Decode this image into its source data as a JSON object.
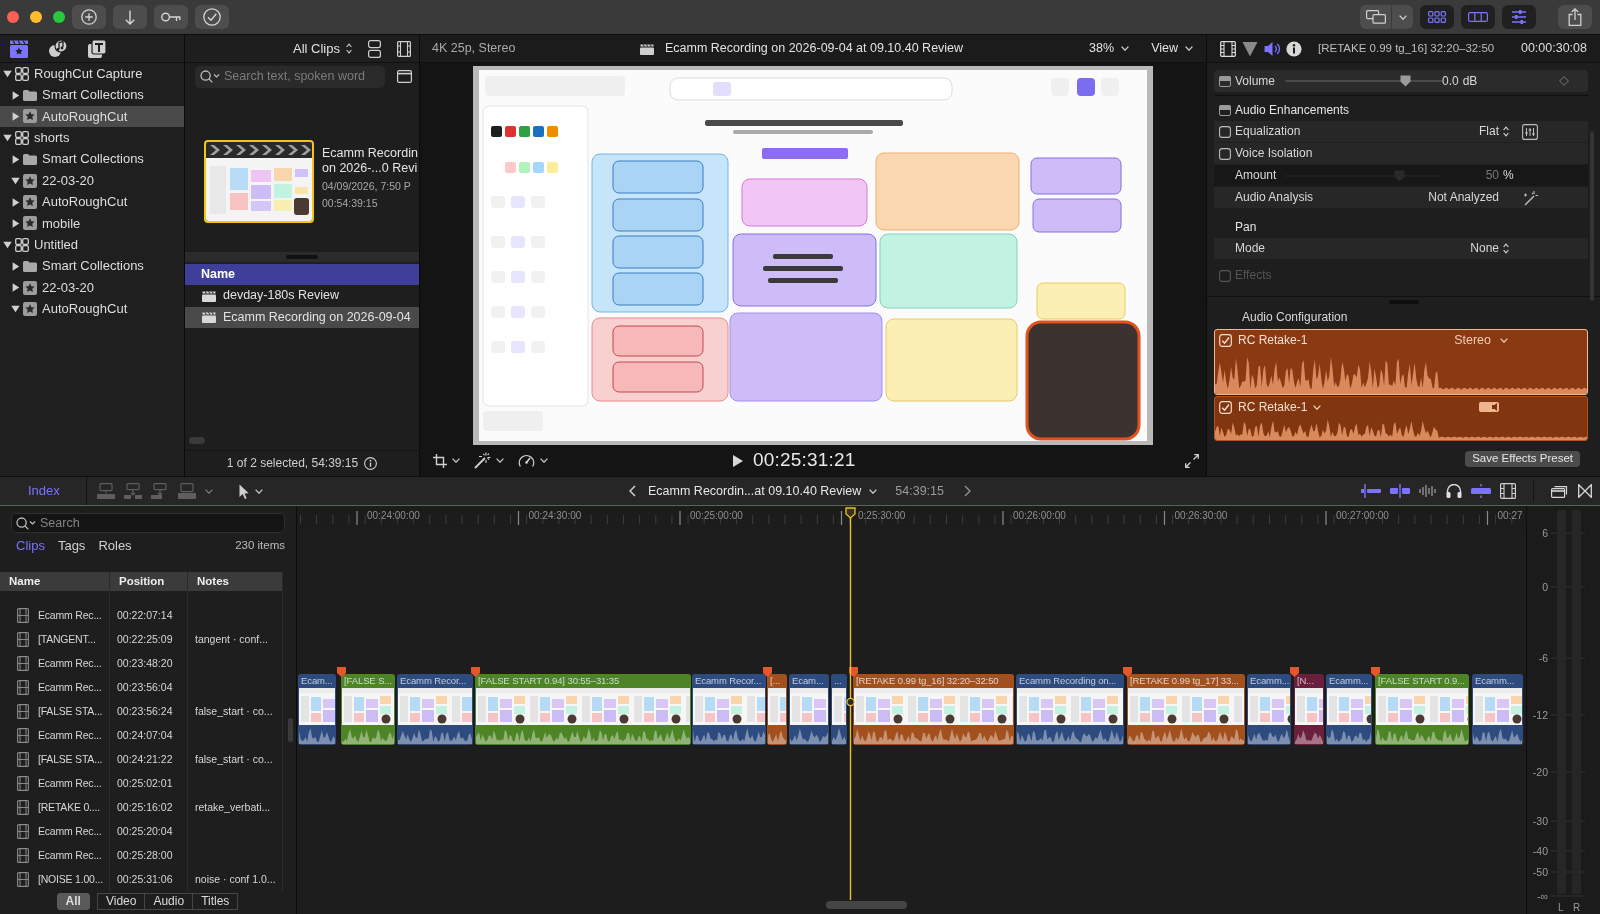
{
  "toolbar": {
    "view_toggles": [
      {
        "on": true
      },
      {
        "on": true
      },
      {
        "on": true
      }
    ]
  },
  "library": {
    "tabs": [
      {
        "selected": true
      },
      {
        "selected": false
      },
      {
        "selected": false
      }
    ],
    "tree": [
      {
        "label": "RoughCut Capture",
        "kind": "library",
        "expanded": true,
        "selected": false,
        "children": [
          {
            "label": "Smart Collections",
            "kind": "folder",
            "expanded": false,
            "selected": false
          },
          {
            "label": "AutoRoughCut",
            "kind": "event",
            "expanded": false,
            "selected": true
          }
        ]
      },
      {
        "label": "shorts",
        "kind": "library",
        "expanded": true,
        "selected": false,
        "children": [
          {
            "label": "Smart Collections",
            "kind": "folder",
            "expanded": false,
            "selected": false
          },
          {
            "label": "22-03-20",
            "kind": "event",
            "expanded": true,
            "selected": false
          },
          {
            "label": "AutoRoughCut",
            "kind": "event",
            "expanded": false,
            "selected": false
          },
          {
            "label": "mobile",
            "kind": "event",
            "expanded": false,
            "selected": false
          }
        ]
      },
      {
        "label": "Untitled",
        "kind": "library",
        "expanded": true,
        "selected": false,
        "children": [
          {
            "label": "Smart Collections",
            "kind": "folder",
            "expanded": false,
            "selected": false
          },
          {
            "label": "22-03-20",
            "kind": "event",
            "expanded": false,
            "selected": false
          },
          {
            "label": "AutoRoughCut",
            "kind": "event",
            "expanded": true,
            "selected": false
          }
        ]
      }
    ]
  },
  "browser": {
    "filter": "All Clips",
    "search": {
      "placeholder": "Search text, spoken word"
    },
    "clip": {
      "title_lines": [
        "Ecamm Recordin",
        "on 2026-...0 Revi"
      ],
      "date": "04/09/2026, 7:50 P",
      "duration": "00:54:39:15",
      "selected": true
    },
    "list": {
      "column": "Name",
      "rows": [
        {
          "name": "devday-180s Review",
          "selected": false
        },
        {
          "name": "Ecamm Recording on 2026-09-04",
          "selected": true
        }
      ]
    },
    "status": "1 of 2 selected, 54:39:15"
  },
  "viewer": {
    "format": "4K 25p, Stereo",
    "title": "Ecamm Recording on 2026-09-04 at 09.10.40 Review",
    "zoom": "38%",
    "view": "View",
    "timecode": "00:25:31:21"
  },
  "inspector": {
    "tabs": [
      {
        "selected": false
      },
      {
        "selected": false
      },
      {
        "selected": true
      },
      {
        "selected": false
      }
    ],
    "clip_name": "[RETAKE 0.99 tg_16] 32:20–32:50",
    "duration": "00:00:30:08",
    "volume": {
      "label": "Volume",
      "level": 0.77,
      "value": "0.0",
      "unit": "dB"
    },
    "sections": [
      {
        "title": "Audio Enhancements",
        "kind": "panel",
        "rows": [
          {
            "kind": "checkbox",
            "label": "Equalization",
            "checked": false,
            "value": "Flat"
          },
          {
            "kind": "checkbox",
            "label": "Voice Isolation",
            "checked": false
          },
          {
            "kind": "slider",
            "label": "Amount",
            "value": "50",
            "unit": "%",
            "level": 0.73
          },
          {
            "kind": "value",
            "label": "Audio Analysis",
            "value": "Not Analyzed"
          }
        ]
      },
      {
        "title": "Pan",
        "kind": "heading",
        "rows": [
          {
            "kind": "popup",
            "label": "Mode",
            "value": "None"
          }
        ]
      }
    ],
    "effects": {
      "label": "Effects",
      "checked": false,
      "disabled": true
    },
    "audio_configuration": {
      "title": "Audio Configuration",
      "components": [
        {
          "name": "RC Retake-1",
          "checked": true,
          "channels": "Stereo",
          "selected": true
        },
        {
          "name": "RC Retake-1",
          "checked": true,
          "selected": false
        }
      ]
    },
    "save_button": "Save Effects Preset"
  },
  "timeline": {
    "index": {
      "tab": "Index",
      "edit_tools": [
        {
          "disabled": true
        },
        {
          "disabled": true
        },
        {
          "disabled": true
        },
        {
          "disabled": true
        }
      ],
      "search": {
        "placeholder": "Search"
      },
      "tabs": [
        {
          "label": "Clips",
          "selected": true
        },
        {
          "label": "Tags",
          "selected": false
        },
        {
          "label": "Roles",
          "selected": false
        }
      ],
      "count": "230 items",
      "columns": [
        "Name",
        "Position",
        "Notes"
      ],
      "rows": [
        {
          "name": "Ecamm Rec...",
          "position": "00:22:07:14"
        },
        {
          "name": "[TANGENT...",
          "position": "00:22:25:09",
          "notes": "tangent · conf..."
        },
        {
          "name": "Ecamm Rec...",
          "position": "00:23:48:20"
        },
        {
          "name": "Ecamm Rec...",
          "position": "00:23:56:04"
        },
        {
          "name": "[FALSE STA...",
          "position": "00:23:56:24",
          "notes": "false_start · co..."
        },
        {
          "name": "Ecamm Rec...",
          "position": "00:24:07:04"
        },
        {
          "name": "[FALSE STA...",
          "position": "00:24:21:22",
          "notes": "false_start · co..."
        },
        {
          "name": "Ecamm Rec...",
          "position": "00:25:02:01"
        },
        {
          "name": "[RETAKE 0....",
          "position": "00:25:16:02",
          "notes": "retake_verbati..."
        },
        {
          "name": "Ecamm Rec...",
          "position": "00:25:20:04"
        },
        {
          "name": "Ecamm Rec...",
          "position": "00:25:28:00"
        },
        {
          "name": "[NOISE 1.00...",
          "position": "00:25:31:06",
          "notes": "noise · conf 1.0..."
        }
      ],
      "filters": [
        {
          "label": "All",
          "selected": true
        },
        {
          "label": "Video",
          "selected": false
        },
        {
          "label": "Audio",
          "selected": false
        },
        {
          "label": "Titles",
          "selected": false
        }
      ]
    },
    "project": "Ecamm Recordin...at 09.10.40 Review",
    "duration": "54:39:15",
    "tools": [
      {
        "on": true
      },
      {
        "on": true
      },
      {
        "on": false
      },
      {
        "on": false
      },
      {
        "on": true
      }
    ],
    "ruler": [
      "00:24:00:00",
      "00:24:30:00",
      "00:25:00:00",
      "0:25:30:00",
      "00:26:00:00",
      "00:26:30:00",
      "00:27:00:00",
      "00:27"
    ],
    "clips": [
      {
        "label": "Ecam...",
        "color": "#2d4b7e",
        "marker": false
      },
      {
        "label": "[FALSE S...",
        "color": "#4d8526",
        "marker": true
      },
      {
        "label": "Ecamm Recor...",
        "color": "#2d4b7e",
        "marker": false
      },
      {
        "label": "[FALSE START 0.94] 30:55–31:35",
        "color": "#4d8526",
        "marker": true
      },
      {
        "label": "Ecamm Recor...",
        "color": "#2d4b7e",
        "marker": false
      },
      {
        "label": "[...",
        "color": "#a3501f",
        "marker": true
      },
      {
        "label": "Ecam...",
        "color": "#2d4b7e",
        "marker": false
      },
      {
        "label": "...",
        "color": "#2d4b7e",
        "marker": false
      },
      {
        "label": "[RETAKE 0.99 tg_16] 32:20–32:50",
        "color": "#a3501f",
        "marker": true
      },
      {
        "label": "Ecamm Recording on...",
        "color": "#2d4b7e",
        "marker": false
      },
      {
        "label": "[RETAKE 0.99 tg_17] 33...",
        "color": "#a3501f",
        "marker": true
      },
      {
        "label": "Ecamm...",
        "color": "#2d4b7e",
        "marker": false
      },
      {
        "label": "[N...",
        "color": "#6a1f3d",
        "marker": true
      },
      {
        "label": "Ecamm...",
        "color": "#2d4b7e",
        "marker": false
      },
      {
        "label": "[FALSE START 0.9...",
        "color": "#4d8526",
        "marker": true
      },
      {
        "label": "Ecamm...",
        "color": "#2d4b7e",
        "marker": false
      }
    ],
    "meter": {
      "scale": [
        "6",
        "0",
        "-6",
        "-12",
        "-20",
        "-30",
        "-40",
        "-50",
        "-∞"
      ],
      "channels": [
        "L",
        "R"
      ]
    }
  }
}
